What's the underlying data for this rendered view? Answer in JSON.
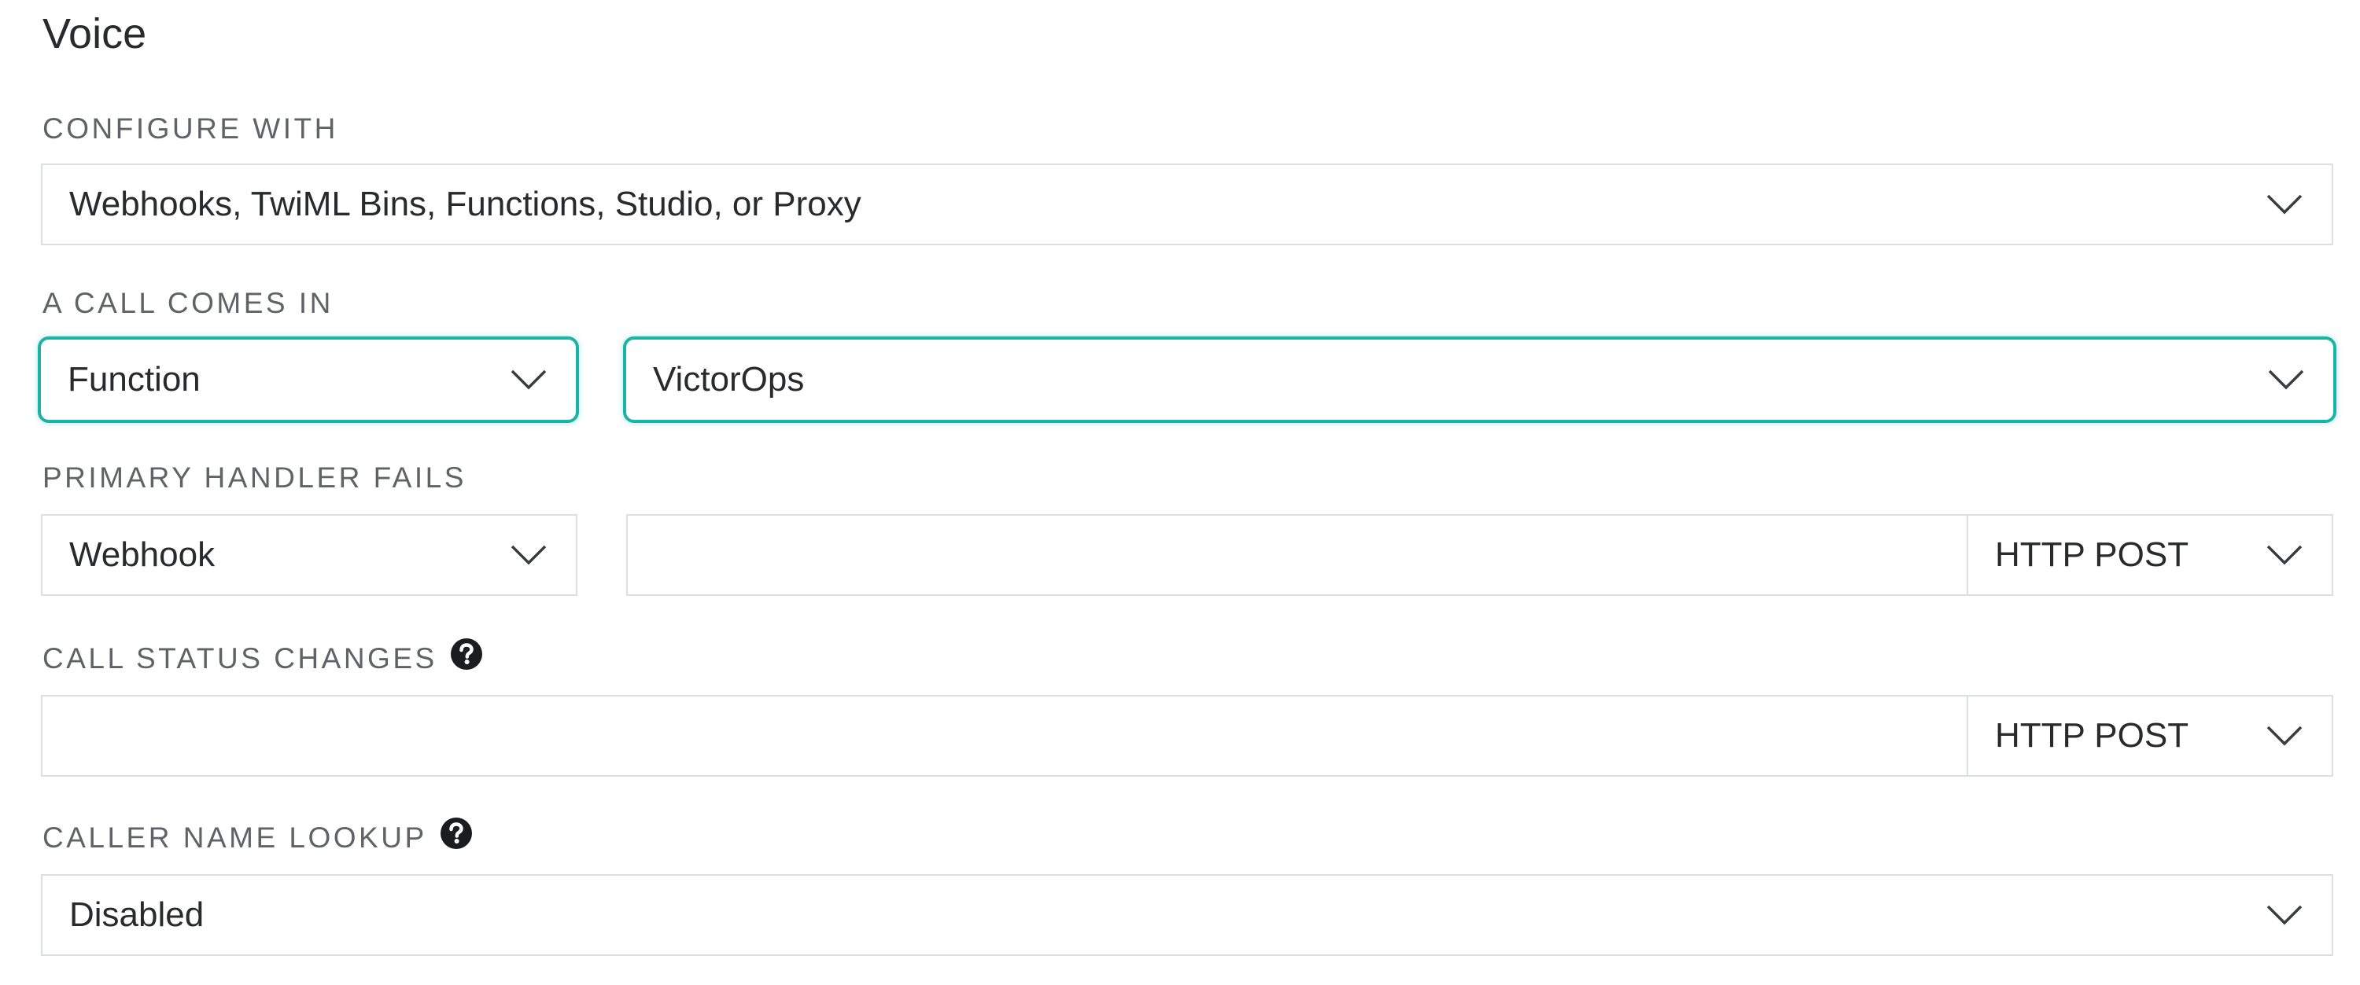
{
  "section": {
    "title": "Voice"
  },
  "configure_with": {
    "label": "CONFIGURE WITH",
    "value": "Webhooks, TwiML Bins, Functions, Studio, or Proxy"
  },
  "call_comes_in": {
    "label": "A CALL COMES IN",
    "type_value": "Function",
    "function_value": "VictorOps"
  },
  "primary_handler_fails": {
    "label": "PRIMARY HANDLER FAILS",
    "type_value": "Webhook",
    "url_value": "",
    "method_value": "HTTP POST"
  },
  "call_status_changes": {
    "label": "CALL STATUS CHANGES",
    "url_value": "",
    "method_value": "HTTP POST"
  },
  "caller_name_lookup": {
    "label": "CALLER NAME LOOKUP",
    "value": "Disabled"
  },
  "icons": {
    "dropdown": "chevron-down-icon",
    "help": "question-circle-icon"
  },
  "colors": {
    "focus_accent": "#1bb3a5",
    "label_text": "#5f6368",
    "border": "#dcdfe2"
  }
}
